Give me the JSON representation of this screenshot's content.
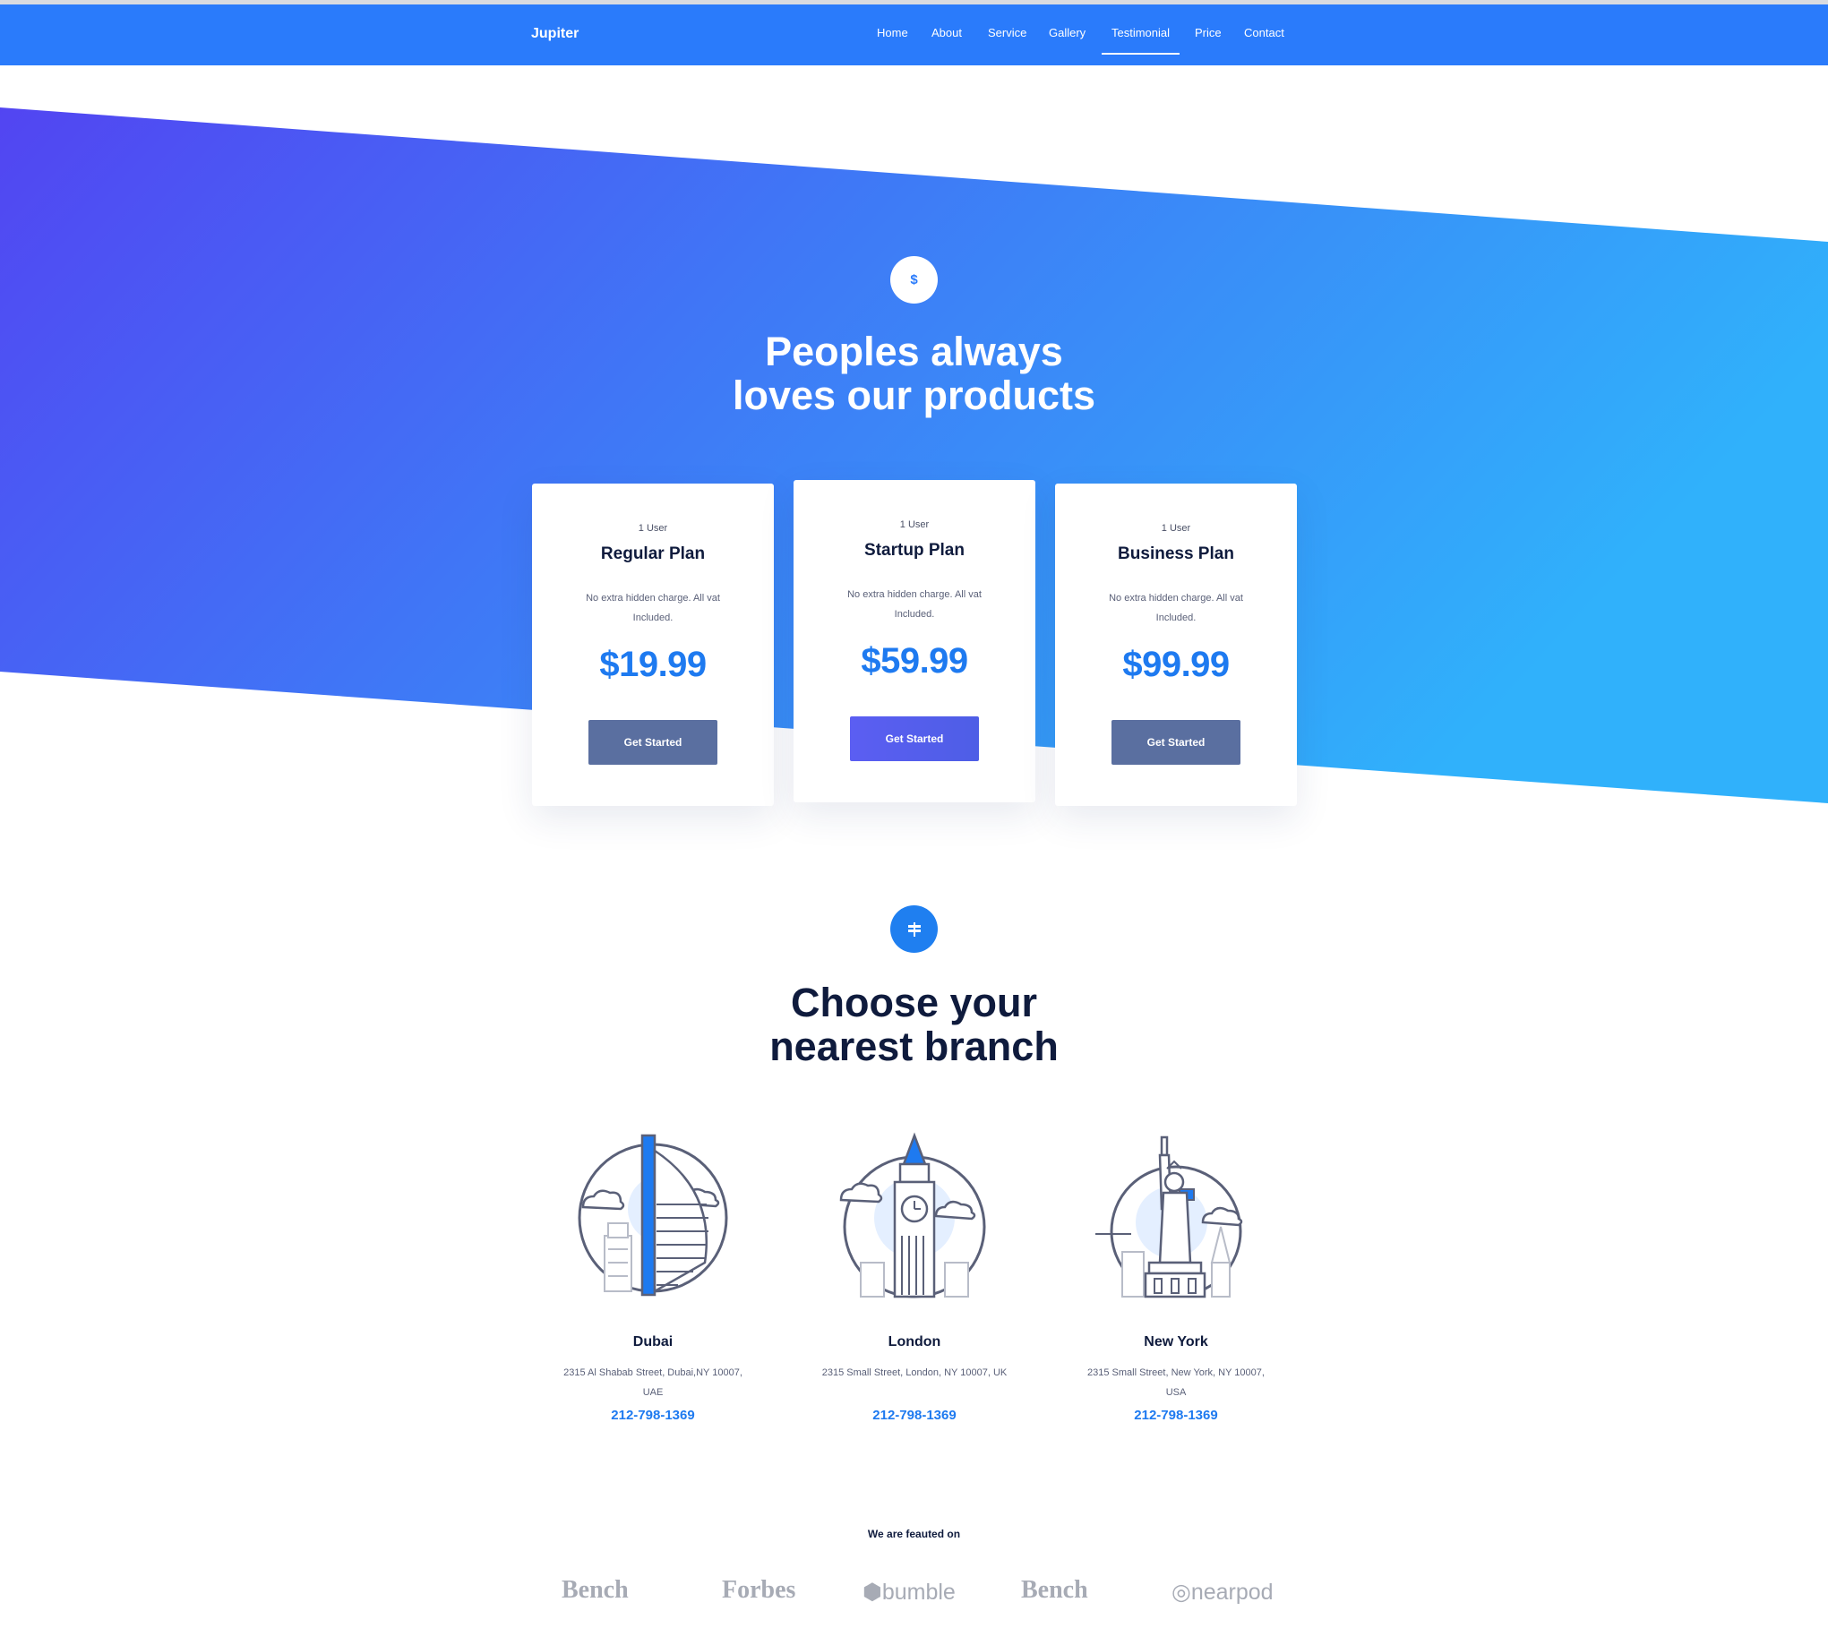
{
  "nav": {
    "logo": "Jupiter",
    "items": [
      {
        "label": "Home"
      },
      {
        "label": "About"
      },
      {
        "label": "Service"
      },
      {
        "label": "Gallery"
      },
      {
        "label": "Testimonial"
      },
      {
        "label": "Price"
      },
      {
        "label": "Contact"
      }
    ],
    "active": "Testimonial"
  },
  "hero": {
    "icon_symbol": "$",
    "title_line1": "Peoples always",
    "title_line2": "loves our products"
  },
  "pricing": {
    "plans": [
      {
        "users": "1 User",
        "name": "Regular Plan",
        "desc": "No extra hidden charge. All vat Included.",
        "price": "$19.99",
        "button": "Get Started"
      },
      {
        "users": "1 User",
        "name": "Startup Plan",
        "desc": "No extra hidden charge. All vat Included.",
        "price": "$59.99",
        "button": "Get Started"
      },
      {
        "users": "1 User",
        "name": "Business Plan",
        "desc": "No extra hidden charge. All vat Included.",
        "price": "$99.99",
        "button": "Get Started"
      }
    ]
  },
  "branches": {
    "icon": "signpost-icon",
    "title_line1": "Choose your",
    "title_line2": "nearest branch",
    "items": [
      {
        "city": "Dubai",
        "address": "2315 Al Shabab Street, Dubai,NY 10007, UAE",
        "phone": "212-798-1369",
        "icon": "burj-al-arab-icon"
      },
      {
        "city": "London",
        "address": "2315 Small Street, London, NY 10007, UK",
        "phone": "212-798-1369",
        "icon": "big-ben-icon"
      },
      {
        "city": "New York",
        "address": "2315 Small Street, New York, NY 10007, USA",
        "phone": "212-798-1369",
        "icon": "statue-of-liberty-icon"
      }
    ]
  },
  "featured": {
    "label": "We are feauted on",
    "brands": [
      "Bench",
      "Forbes",
      "bumble",
      "Bench",
      "nearpod"
    ]
  },
  "colors": {
    "nav_blue": "#2a7bfb",
    "gradient_start": "#5245f2",
    "gradient_end": "#30b1fb",
    "accent_blue": "#1e7af0",
    "button_slate": "#5a6fa0",
    "heading_dark": "#0f1b3d"
  }
}
